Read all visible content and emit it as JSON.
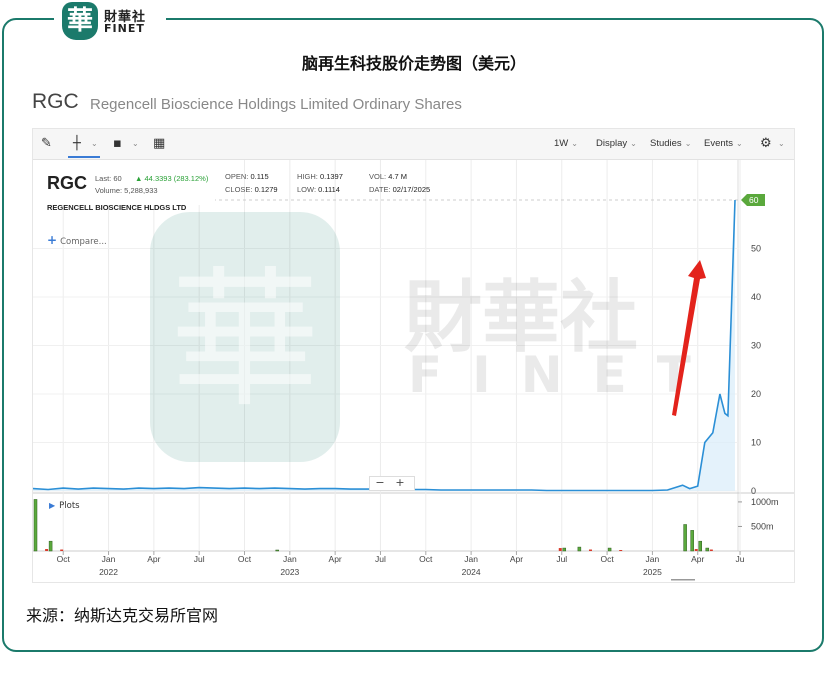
{
  "brand": {
    "seal_char": "華",
    "name_cn": "財華社",
    "name_en": "FINET"
  },
  "title": "脑再生科技股价走势图（美元）",
  "header": {
    "ticker": "RGC",
    "company_full": "Regencell Bioscience Holdings Limited Ordinary Shares"
  },
  "toolbar": {
    "period": "1W",
    "display": "Display",
    "studies": "Studies",
    "events": "Events"
  },
  "quote": {
    "symbol": "RGC",
    "company": "REGENCELL BIOSCIENCE HLDGS LTD",
    "last_label": "Last: 60",
    "change": "44.3393 (283.12%)",
    "volume_label": "Volume: 5,288,933",
    "open_label": "OPEN:",
    "open": "0.115",
    "close_label": "CLOSE:",
    "close": "0.1279",
    "high_label": "HIGH:",
    "high": "0.1397",
    "low_label": "LOW:",
    "low": "0.1114",
    "vol_label": "VOL:",
    "vol": "4.7 M",
    "date_label": "DATE:",
    "date": "02/17/2025"
  },
  "compare_label": "Compare...",
  "plots_label": "Plots",
  "zoom": {
    "minus": "−",
    "plus": "+"
  },
  "colors": {
    "line": "#2b8fd6",
    "fill": "#d8ecfa",
    "volume_up": "#5aa83c",
    "volume_down": "#d93a2b",
    "brand": "#1b7a6b",
    "arrow": "#e3231c"
  },
  "watermark": {
    "cn": "財華社",
    "en": "FINET"
  },
  "source": "来源：纳斯达克交易所官网",
  "chart_data": {
    "type": "line",
    "x": [
      "2021-08",
      "2021-09",
      "2021-10",
      "2021-11",
      "2021-12",
      "2022-01",
      "2022-02",
      "2022-03",
      "2022-04",
      "2022-05",
      "2022-06",
      "2022-07",
      "2022-08",
      "2022-09",
      "2022-10",
      "2022-11",
      "2022-12",
      "2023-01",
      "2023-02",
      "2023-03",
      "2023-04",
      "2023-05",
      "2023-06",
      "2023-07",
      "2023-08",
      "2023-09",
      "2023-10",
      "2023-11",
      "2023-12",
      "2024-01",
      "2024-02",
      "2024-03",
      "2024-04",
      "2024-05",
      "2024-06",
      "2024-07",
      "2024-08",
      "2024-09",
      "2024-10",
      "2024-11",
      "2024-12",
      "2025-01",
      "2025-02",
      "2025-03",
      "2025-03-15",
      "2025-04",
      "2025-04-15",
      "2025-05",
      "2025-05-15",
      "2025-05-25",
      "2025-06",
      "2025-06-15"
    ],
    "series": [
      {
        "values": [
          0.5,
          0.3,
          0.6,
          0.4,
          0.6,
          0.5,
          0.4,
          0.6,
          0.5,
          0.6,
          0.5,
          0.7,
          0.6,
          0.5,
          0.6,
          0.5,
          0.6,
          0.5,
          0.4,
          0.5,
          0.5,
          0.4,
          0.4,
          0.4,
          0.3,
          0.3,
          0.3,
          0.2,
          0.2,
          0.2,
          0.2,
          0.2,
          0.2,
          0.2,
          0.1,
          0.1,
          0.1,
          0.1,
          0.1,
          0.1,
          0.1,
          0.1,
          0.2,
          1.2,
          0.5,
          1.0,
          10,
          12,
          20,
          16,
          15.5,
          60
        ]
      }
    ],
    "ylim": [
      0,
      60
    ],
    "y_ticks": [
      0,
      10,
      20,
      30,
      40,
      50
    ],
    "last_value_label": "60",
    "x_tick_labels": [
      "Oct",
      "Jan",
      "Apr",
      "Jul",
      "Oct",
      "Jan",
      "Apr",
      "Jul",
      "Oct",
      "Jan",
      "Apr",
      "Jul",
      "Oct",
      "Jan",
      "Apr",
      "Ju"
    ],
    "year_labels": [
      "2022",
      "2023",
      "2024",
      "2025"
    ],
    "volume_axis_labels": [
      "1000m",
      "500m"
    ],
    "volume": {
      "up": [
        [
          "2021-08",
          1050
        ],
        [
          "2021-09",
          200
        ],
        [
          "2022-12",
          0
        ],
        [
          "2024-07",
          60
        ],
        [
          "2024-08",
          80
        ],
        [
          "2024-10",
          60
        ],
        [
          "2025-03",
          540
        ],
        [
          "2025-03-15",
          420
        ],
        [
          "2025-04",
          200
        ],
        [
          "2025-04-15",
          60
        ]
      ],
      "down": [
        [
          "2021-09",
          40
        ],
        [
          "2021-10",
          30
        ],
        [
          "2024-07",
          60
        ],
        [
          "2024-09",
          30
        ],
        [
          "2024-11",
          20
        ],
        [
          "2025-04",
          40
        ],
        [
          "2025-05",
          30
        ]
      ]
    },
    "grid": true
  }
}
